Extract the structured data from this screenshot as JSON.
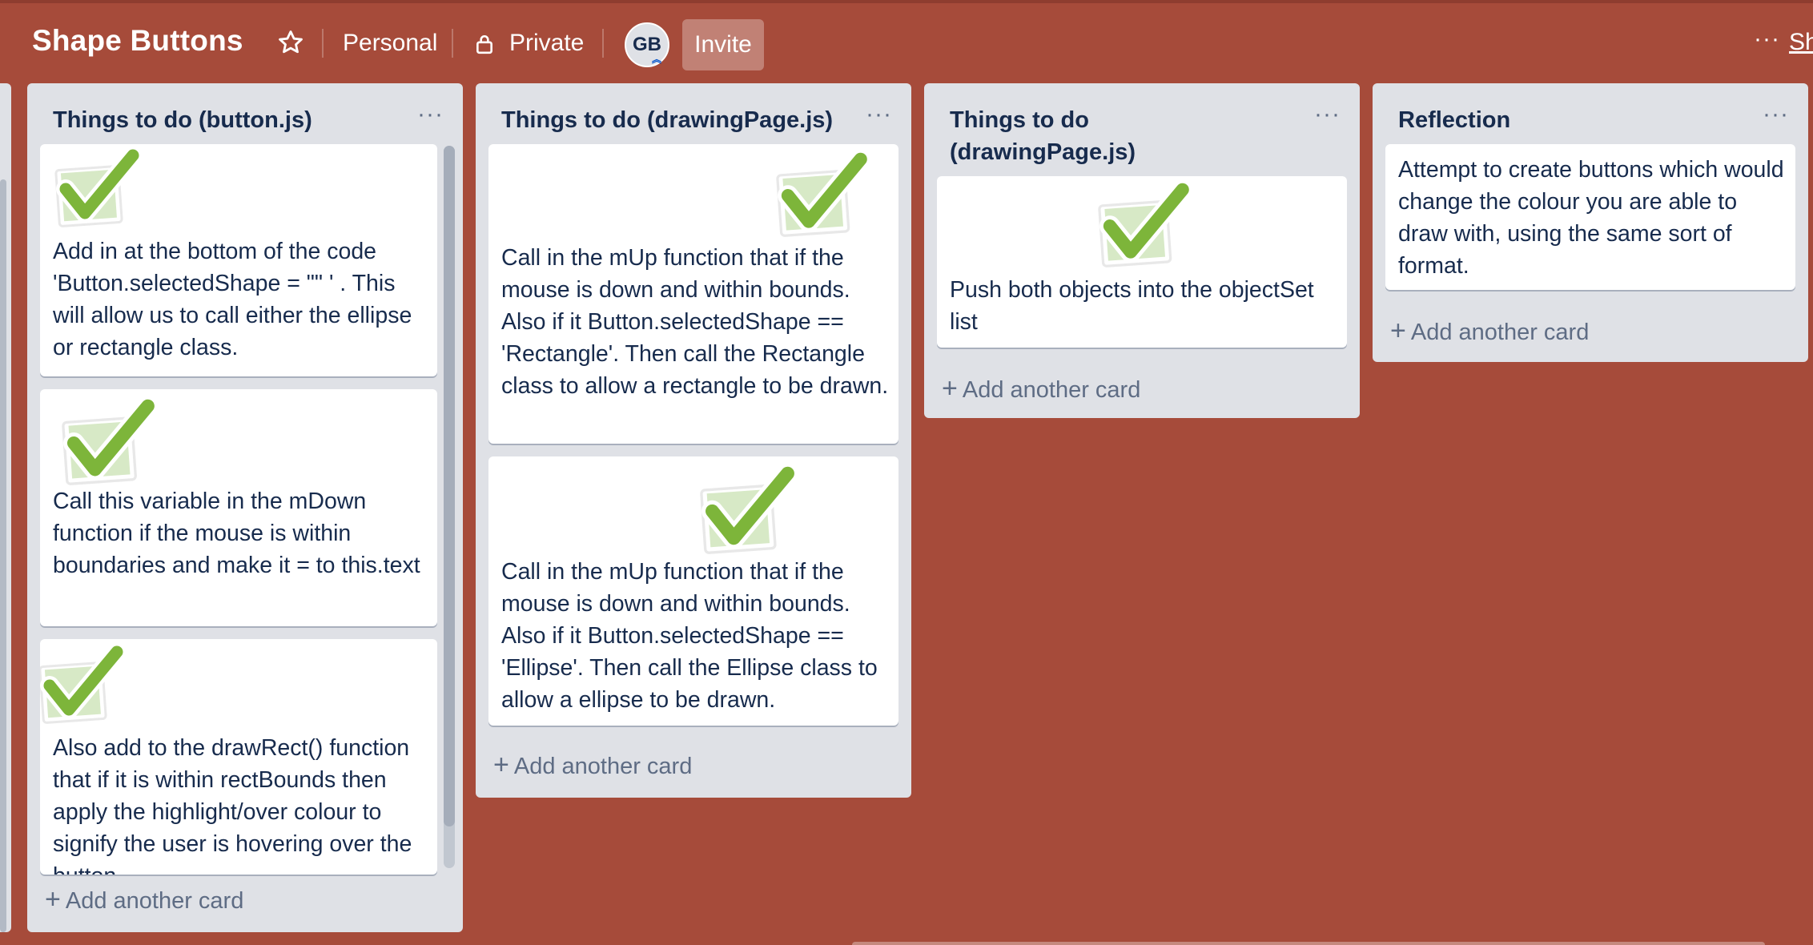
{
  "header": {
    "board_title": "Shape Buttons",
    "team": "Personal",
    "visibility": "Private",
    "avatar_initials": "GB",
    "invite_label": "Invite",
    "menu_label": "···",
    "show_menu_label": "Sh"
  },
  "lists": [
    {
      "title": "Things to do (button.js)",
      "cards": [
        "Add in at the bottom of the code 'Button.selectedShape = \"\" ' . This will allow us to call either the ellipse or rectangle class.",
        "Call this variable in the mDown function if the mouse is within boundaries and make it = to this.text",
        "Also add to the drawRect() function that if it is within rectBounds then apply the highlight/over colour to signify the user is hovering over the button."
      ],
      "add_label": "Add another card"
    },
    {
      "title": "Things to do (drawingPage.js)",
      "cards": [
        "Call in the mUp function that if the mouse is down and within bounds. Also if it Button.selectedShape == 'Rectangle'. Then call the Rectangle class to allow a rectangle to be drawn.",
        "Call in the mUp function that if the mouse is down and within bounds. Also if it Button.selectedShape == 'Ellipse'. Then call the Ellipse class to allow a ellipse to be drawn."
      ],
      "add_label": "Add another card"
    },
    {
      "title": "Things to do (drawingPage.js)",
      "cards": [
        "Push both objects into the objectSet list"
      ],
      "add_label": "Add another card"
    },
    {
      "title": "Reflection",
      "cards": [
        "Attempt to create buttons which would change the colour you are able to draw with, using the same sort of format."
      ],
      "add_label": "Add another card"
    }
  ],
  "icons": {
    "star": "star-icon",
    "lock": "lock-icon",
    "check": "green-checkmark-sticker"
  },
  "colors": {
    "board_background": "#A64B3A",
    "list_background": "#DFE1E6",
    "card_text": "#172B4D",
    "check_green": "#7DB53A"
  }
}
